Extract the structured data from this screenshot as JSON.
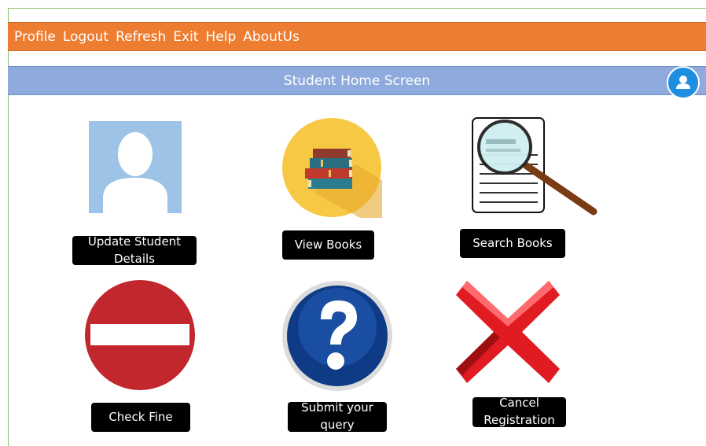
{
  "menu": {
    "items": [
      "Profile",
      "Logout",
      "Refresh",
      "Exit",
      "Help",
      "AboutUs"
    ]
  },
  "header": {
    "title": "Student Home Screen"
  },
  "tiles": {
    "update_student": {
      "label": "Update Student Details"
    },
    "view_books": {
      "label": "View Books"
    },
    "search_books": {
      "label": "Search Books"
    },
    "check_fine": {
      "label": "Check Fine"
    },
    "submit_query": {
      "label": "Submit your query"
    },
    "cancel_registration": {
      "label": "Cancel Registration"
    }
  },
  "colors": {
    "menubar": "#ed7d31",
    "titlebar": "#8faadc",
    "label_bg": "#000000"
  },
  "icons": [
    "user-avatar-icon",
    "books-icon",
    "magnifier-document-icon",
    "no-entry-icon",
    "question-mark-icon",
    "red-x-icon",
    "profile-icon"
  ]
}
